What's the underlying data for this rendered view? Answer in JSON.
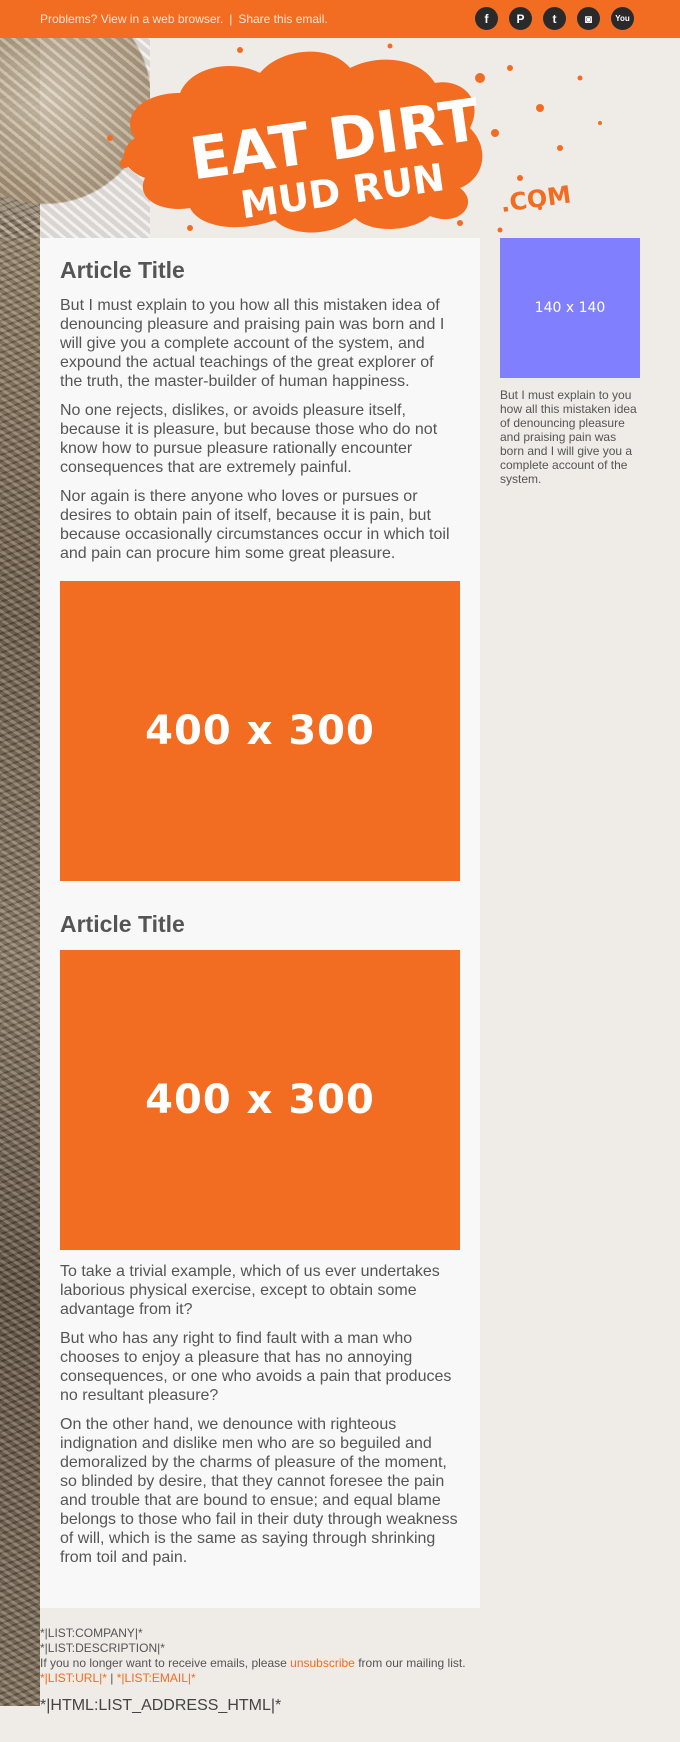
{
  "topbar": {
    "view_link": "Problems? View in a web browser.",
    "separator": "|",
    "share_link": "Share this email."
  },
  "social": [
    {
      "icon": "facebook-icon",
      "glyph": "f"
    },
    {
      "icon": "pinterest-icon",
      "glyph": "P"
    },
    {
      "icon": "twitter-icon",
      "glyph": "t"
    },
    {
      "icon": "instagram-icon",
      "glyph": "◙"
    },
    {
      "icon": "youtube-icon",
      "glyph": "You"
    }
  ],
  "logo": {
    "line1": "EAT DIRT",
    "line2": "MUD RUN",
    "suffix": ".COM"
  },
  "article1": {
    "title": "Article Title",
    "p1": "But I must explain to you how all this mistaken idea of denouncing pleasure and praising pain was born and I will give you a complete account of the system, and expound the actual teachings of the great explorer of the truth, the master-builder of human happiness.",
    "p2": "No one rejects, dislikes, or avoids pleasure itself, because it is pleasure, but because those who do not know how to pursue pleasure rationally encounter consequences that are extremely painful.",
    "p3": "Nor again is there anyone who loves or pursues or desires to obtain pain of itself, because it is pain, but because occasionally circumstances occur in which toil and pain can procure him some great pleasure.",
    "image_label": "400 x 300"
  },
  "article2": {
    "title": "Article Title",
    "image_label": "400 x 300",
    "p1": "To take a trivial example, which of us ever undertakes laborious physical exercise, except to obtain some advantage from it?",
    "p2": "But who has any right to find fault with a man who chooses to enjoy a pleasure that has no annoying consequences, or one who avoids a pain that produces no resultant pleasure?",
    "p3": "On the other hand, we denounce with righteous indignation and dislike men who are so beguiled and demoralized by the charms of pleasure of the moment, so blinded by desire, that they cannot foresee the pain and trouble that are bound to ensue; and equal blame belongs to those who fail in their duty through weakness of will, which is the same as saying through shrinking from toil and pain."
  },
  "sidebar": {
    "image_label": "140 x 140",
    "text": "But I must explain to you how all this mistaken idea of denouncing pleasure and praising pain was born and I will give you a complete account of the system."
  },
  "footer": {
    "company": "*|LIST:COMPANY|*",
    "description": "*|LIST:DESCRIPTION|*",
    "unsub_pre": "If you no longer want to receive emails, please ",
    "unsub_link": "unsubscribe",
    "unsub_post": " from our mailing list.",
    "list_url": "*|LIST:URL|*",
    "list_sep": " | ",
    "list_email": "*|LIST:EMAIL|*",
    "address": "*|HTML:LIST_ADDRESS_HTML|*"
  },
  "colors": {
    "brand_orange": "#f26d21",
    "thumb_purple": "#8080ff"
  }
}
